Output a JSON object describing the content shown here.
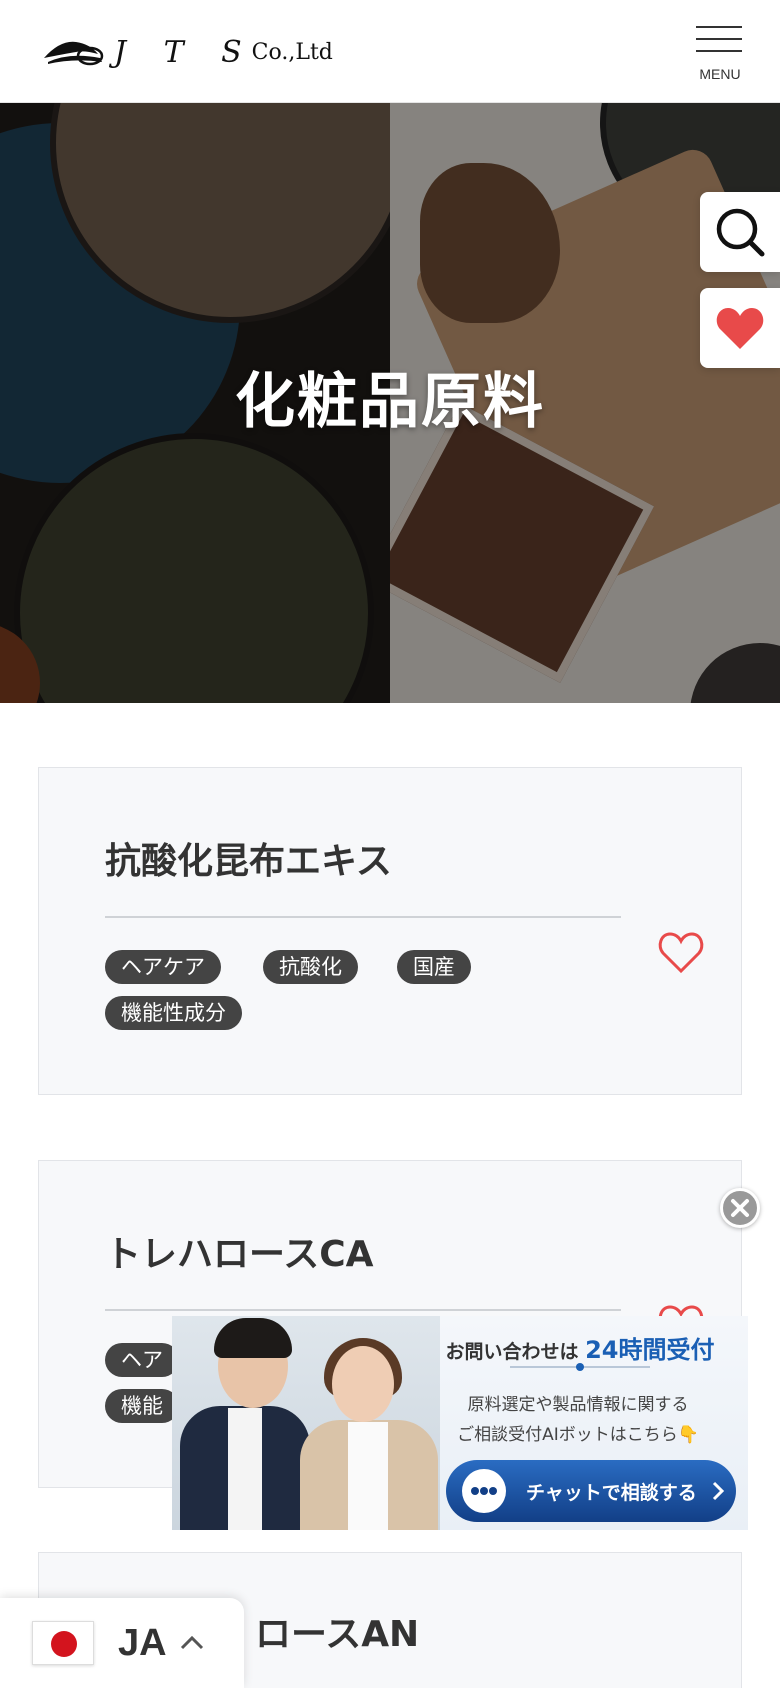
{
  "header": {
    "logo_text": "J T S",
    "logo_suffix": "Co.,Ltd",
    "menu_label": "MENU"
  },
  "hero": {
    "title": "化粧品原料"
  },
  "side_buttons": {
    "search_icon": "search-icon",
    "favorite_icon": "heart-icon"
  },
  "products": [
    {
      "name": "抗酸化昆布エキス",
      "tags": [
        "ヘアケア",
        "抗酸化",
        "国産",
        "機能性成分"
      ]
    },
    {
      "name": "トレハロースCA",
      "tags": [
        "ヘア",
        "機能"
      ]
    },
    {
      "name": "ロースAN",
      "tags": []
    }
  ],
  "chat": {
    "line1_pre": "お問い合わせは",
    "line1_highlight": "24時間受付",
    "line2": "原料選定や製品情報に関する",
    "line3": "ご相談受付AIボットはこちら👇",
    "button_label": "チャットで相談する"
  },
  "language": {
    "code": "JA"
  },
  "colors": {
    "tag_bg": "#444444",
    "heart": "#e84a4a",
    "chat_blue": "#1a5fb4"
  }
}
